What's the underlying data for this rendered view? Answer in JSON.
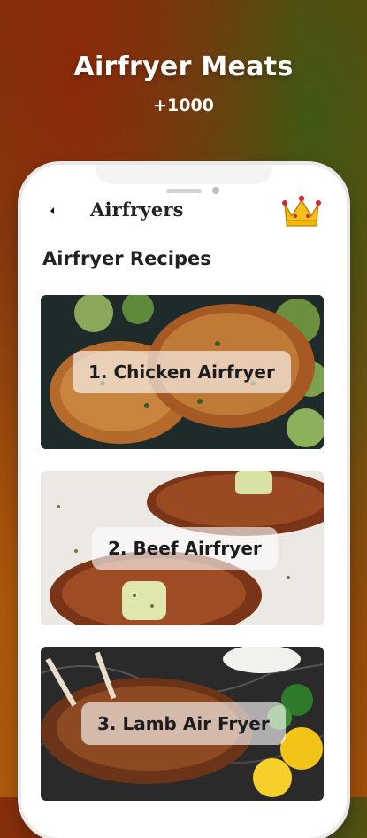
{
  "hero": {
    "title": "Airfryer Meats",
    "count": "+1000"
  },
  "app_bar": {
    "title": "Airfryers",
    "back_icon": "chevron-left-icon",
    "premium_icon": "crown-icon"
  },
  "section": {
    "title": "Airfryer Recipes"
  },
  "recipes": [
    {
      "label": "1. Chicken Airfryer"
    },
    {
      "label": "2. Beef Airfryer"
    },
    {
      "label": "3. Lamb Air Fryer"
    }
  ],
  "colors": {
    "crown": "#f2b705",
    "crown_jewel": "#d7263d",
    "card_label_bg": "#ffffff"
  }
}
